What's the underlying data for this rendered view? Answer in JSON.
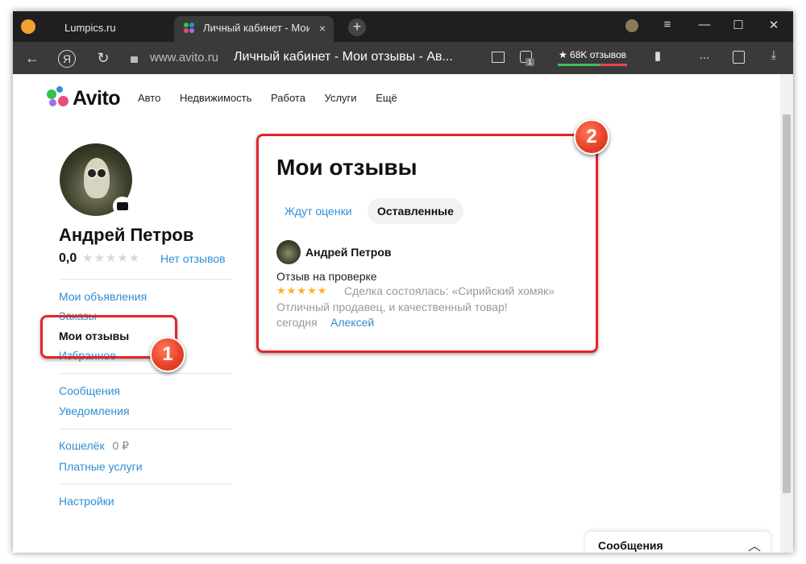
{
  "browser": {
    "tabs": [
      {
        "title": "Lumpics.ru"
      },
      {
        "title": "Личный кабинет - Мои"
      }
    ],
    "url_domain": "www.avito.ru",
    "page_title": "Личный кабинет - Мои отзывы - Ав...",
    "reviews_button": "★ 68K отзывов",
    "extension_badge": "1",
    "icons": {
      "back": "←",
      "yandex": "Я",
      "reload": "↻",
      "lock": "🔒",
      "menu": "≡",
      "minimize": "—",
      "maximize": "☐",
      "close": "✕",
      "tab_close": "×",
      "newtab": "+",
      "bookmark": "▮",
      "more": "...",
      "downloads": "⤓"
    }
  },
  "site": {
    "logo_text": "Avito",
    "nav": [
      "Авто",
      "Недвижимость",
      "Работа",
      "Услуги",
      "Ещё"
    ]
  },
  "profile": {
    "name": "Андрей Петров",
    "rating": "0,0",
    "stars": "★★★★★",
    "no_reviews": "Нет отзывов"
  },
  "sidebar": {
    "items": [
      {
        "label": "Мои объявления"
      },
      {
        "label": "Заказы"
      },
      {
        "label": "Мои отзывы"
      },
      {
        "label": "Избранное"
      },
      {
        "label": "Сообщения"
      },
      {
        "label": "Уведомления"
      },
      {
        "label": "Кошелёк"
      },
      {
        "label": "Платные услуги"
      },
      {
        "label": "Настройки"
      }
    ],
    "wallet_value": "0 ₽"
  },
  "main": {
    "title": "Мои отзывы",
    "tabs": [
      {
        "label": "Ждут оценки"
      },
      {
        "label": "Оставленные"
      }
    ],
    "review": {
      "author": "Андрей Петров",
      "status": "Отзыв на проверке",
      "stars": "★★★★★",
      "deal": "Сделка состоялась: «Сирийский хомяк»",
      "text": "Отличный продавец, и качественный товар!",
      "date": "сегодня",
      "recipient": "Алексей"
    }
  },
  "messages_panel": {
    "label": "Сообщения",
    "chevron": "︿"
  },
  "annotations": {
    "badges": [
      "1",
      "2"
    ],
    "color": "#e0252a"
  }
}
